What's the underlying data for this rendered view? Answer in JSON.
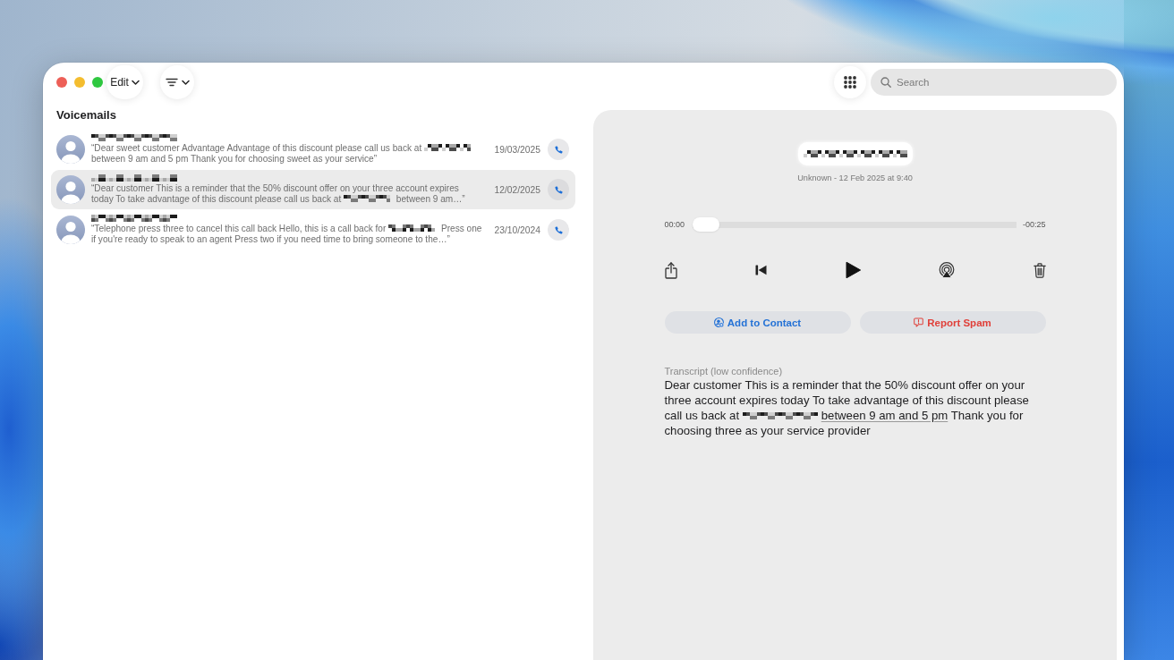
{
  "toolbar": {
    "edit_label": "Edit",
    "search": {
      "placeholder": "Search"
    }
  },
  "list_title": "Voicemails",
  "voicemails": [
    {
      "caller_pixelated": true,
      "preview": [
        {
          "kind": "text",
          "text": "“Dear sweet customer Advantage Advantage of this discount please call us back at "
        },
        {
          "kind": "redacted"
        },
        {
          "kind": "text",
          "text": " between 9 am and 5 pm Thank you for choosing sweet as your service”"
        }
      ],
      "date": "19/03/2025",
      "selected": false
    },
    {
      "caller_pixelated": true,
      "preview": [
        {
          "kind": "text",
          "text": "“Dear customer This is a reminder that the 50% discount offer on your three account expires today To take advantage of this discount please call us back at "
        },
        {
          "kind": "redacted"
        },
        {
          "kind": "text",
          "text": " between 9 am…”"
        }
      ],
      "date": "12/02/2025",
      "selected": true
    },
    {
      "caller_pixelated": true,
      "preview": [
        {
          "kind": "text",
          "text": "“Telephone press three to cancel this call back Hello, this is a call back for "
        },
        {
          "kind": "redacted"
        },
        {
          "kind": "text",
          "text": " Press one if you're ready to speak to an agent Press two if you need time to bring someone to the…”"
        }
      ],
      "date": "23/10/2024",
      "selected": false
    }
  ],
  "detail": {
    "number_pixelated": true,
    "subtitle": "Unknown - 12 Feb 2025 at 9:40",
    "player": {
      "elapsed": "00:00",
      "remaining": "-00:25",
      "level": 0
    },
    "actions": [
      {
        "kind": "add_contact",
        "label": "Add to Contact"
      },
      {
        "kind": "report_spam",
        "label": "Report Spam"
      }
    ],
    "transcript_label": "Transcript (low confidence)",
    "transcript": [
      {
        "kind": "text",
        "text": "Dear customer This is a reminder that the 50% discount offer on your three account expires today To take advantage of this discount please call us back at "
      },
      {
        "kind": "redacted"
      },
      {
        "kind": "link",
        "text": "between 9 am and 5 pm"
      },
      {
        "kind": "text",
        "text": " Thank you for choosing three as your service provider"
      }
    ]
  }
}
